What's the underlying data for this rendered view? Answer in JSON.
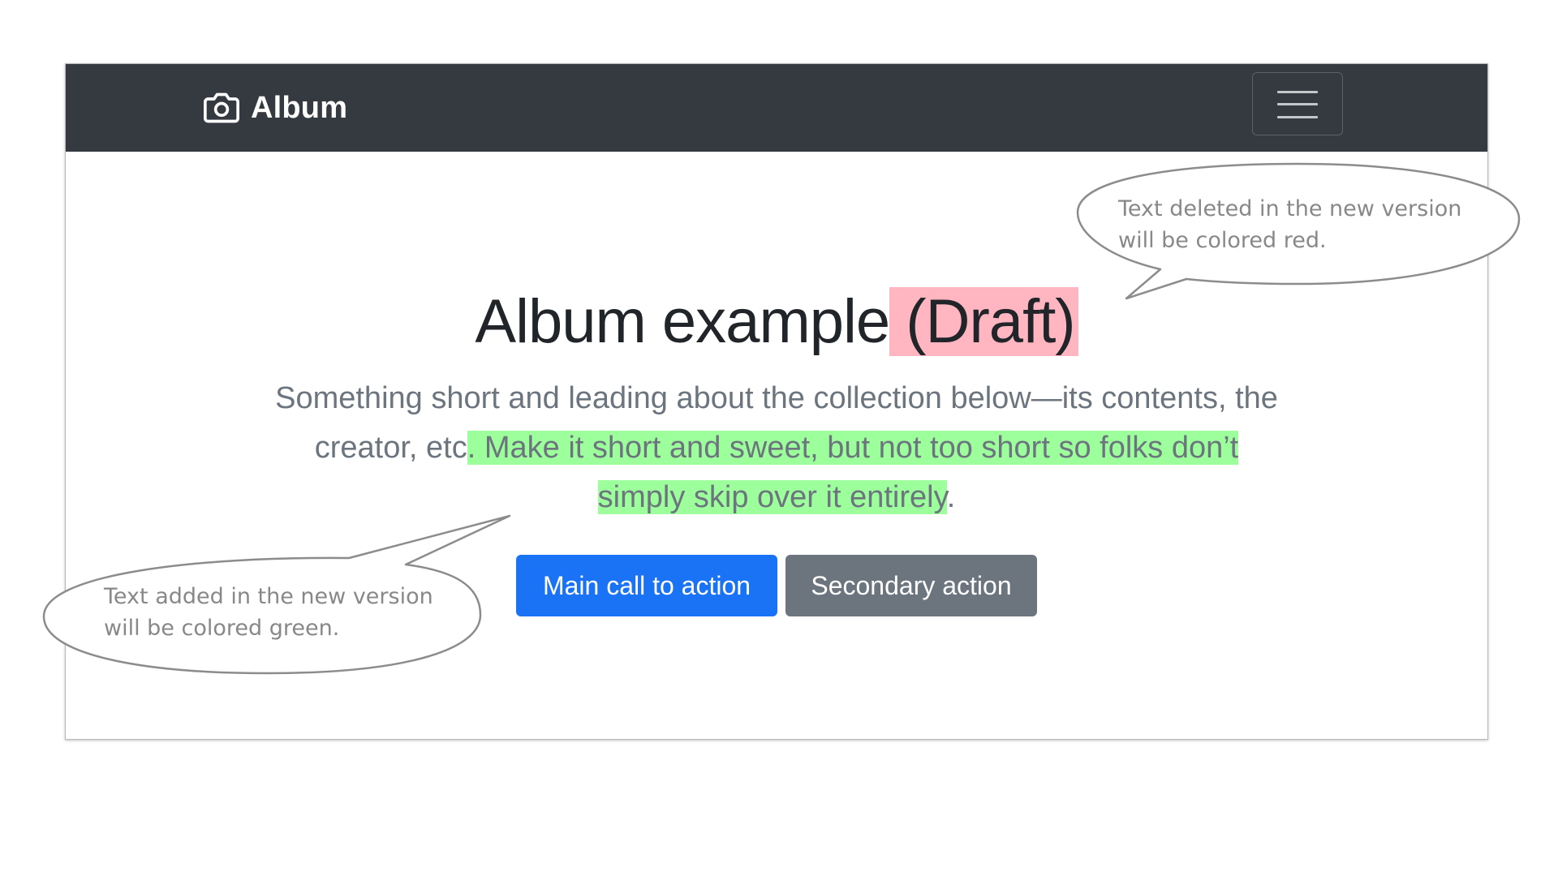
{
  "navbar": {
    "brand_icon": "camera-icon",
    "brand": "Album",
    "toggler_icon": "hamburger-menu-icon",
    "background": "#343a40"
  },
  "hero": {
    "heading_main": "Album example",
    "heading_deleted": " (Draft)",
    "lead_unchanged_1": "Something short and leading about the collection below—its contents, the creator, etc",
    "lead_added": ". Make it short and sweet, but not too short so folks don’t simply skip over it entirely",
    "lead_unchanged_2": "."
  },
  "buttons": {
    "primary": "Main call to action",
    "secondary": "Secondary action"
  },
  "annotations": {
    "deleted_note_line1": "Text deleted in the new version",
    "deleted_note_line2": "will be colored red.",
    "added_note_line1": "Text added in the new version",
    "added_note_line2": "will be colored green."
  },
  "colors": {
    "deleted_highlight": "#ffb6c1",
    "added_highlight": "#9cff9c",
    "primary_button": "#1a73f5",
    "secondary_button": "#6c757d"
  }
}
